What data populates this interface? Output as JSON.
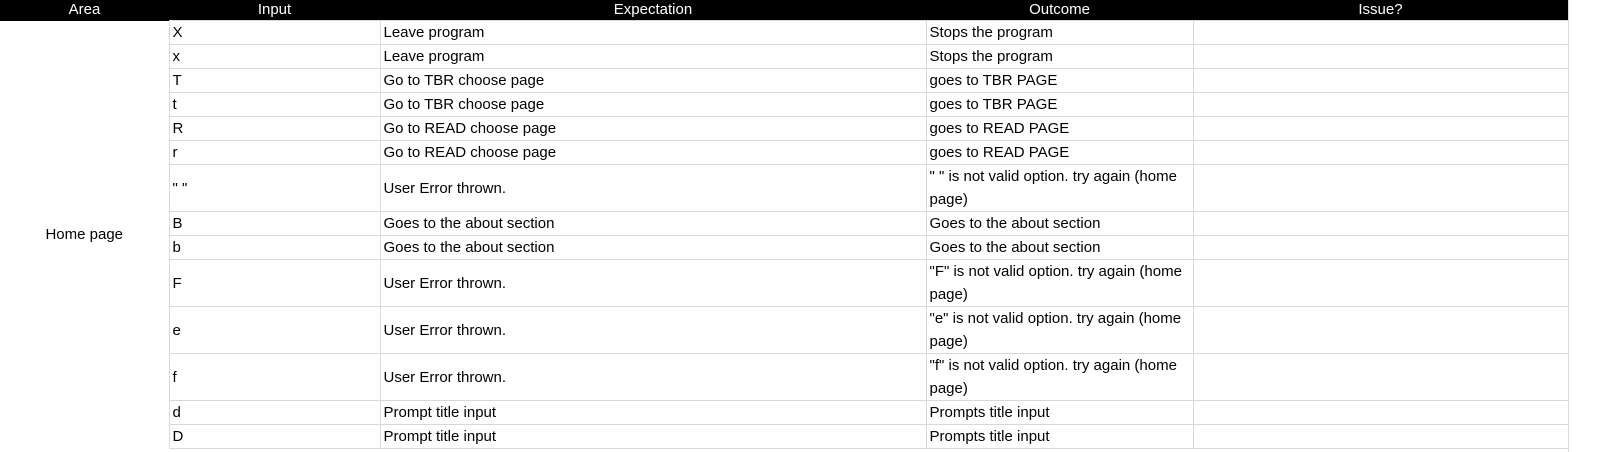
{
  "headers": [
    "Area",
    "Input",
    "Expectation",
    "Outcome",
    "Issue?"
  ],
  "area": "Home page",
  "rows": [
    {
      "input": "X",
      "expectation": "Leave program",
      "outcome": "Stops the program",
      "issue": ""
    },
    {
      "input": "x",
      "expectation": "Leave program",
      "outcome": "Stops the program",
      "issue": ""
    },
    {
      "input": "T",
      "expectation": "Go to TBR choose page",
      "outcome": "goes to TBR PAGE",
      "issue": ""
    },
    {
      "input": "t",
      "expectation": "Go to TBR choose page",
      "outcome": "goes to TBR PAGE",
      "issue": ""
    },
    {
      "input": "R",
      "expectation": "Go to READ choose page",
      "outcome": "goes to READ PAGE",
      "issue": ""
    },
    {
      "input": "r",
      "expectation": "Go to READ choose page",
      "outcome": "goes to READ PAGE",
      "issue": ""
    },
    {
      "input": "\" \"",
      "expectation": "User Error thrown.",
      "outcome": "\" \" is not valid option. try again (home page)",
      "issue": ""
    },
    {
      "input": "B",
      "expectation": "Goes to the about section",
      "outcome": "Goes to the about section",
      "issue": ""
    },
    {
      "input": "b",
      "expectation": "Goes to the about section",
      "outcome": "Goes to the about section",
      "issue": ""
    },
    {
      "input": "F",
      "expectation": "User Error thrown.",
      "outcome": "\"F\" is not valid option. try again (home page)",
      "issue": ""
    },
    {
      "input": "e",
      "expectation": "User Error thrown.",
      "outcome": "\"e\" is not valid option. try again (home page)",
      "issue": ""
    },
    {
      "input": "f",
      "expectation": "User Error thrown.",
      "outcome": "\"f\" is not valid option. try again (home page)",
      "issue": ""
    },
    {
      "input": "d",
      "expectation": "Prompt title input",
      "outcome": "Prompts title input",
      "issue": ""
    },
    {
      "input": "D",
      "expectation": "Prompt title input",
      "outcome": "Prompts title input",
      "issue": ""
    }
  ]
}
